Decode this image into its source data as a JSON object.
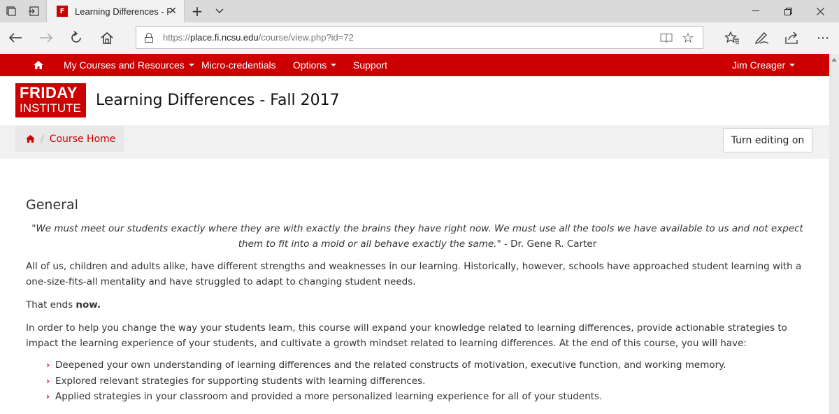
{
  "browser": {
    "tab_title": "Learning Differences - F",
    "url_prefix": "https://",
    "url_host": "place.fi.ncsu.edu",
    "url_path": "/course/view.php?id=72"
  },
  "sitenav": {
    "items": [
      {
        "label": "My Courses and Resources",
        "dropdown": true
      },
      {
        "label": "Micro-credentials",
        "dropdown": false
      },
      {
        "label": "Options",
        "dropdown": true
      },
      {
        "label": "Support",
        "dropdown": false
      }
    ],
    "user": "Jim Creager"
  },
  "header": {
    "logo_line1": "FRIDAY",
    "logo_line2": "INSTITUTE",
    "course_title": "Learning Differences - Fall 2017"
  },
  "breadcrumb": {
    "separator": "/",
    "current": "Course Home"
  },
  "edit_button": "Turn editing on",
  "content": {
    "heading": "General",
    "quote_text": "\"We must meet our students exactly where they are with exactly the brains they have right now. We must use all the tools we have available to us and not expect them to fit into a mold or all behave exactly the same.\"",
    "quote_author": "- Dr. Gene R. Carter",
    "para1": "All of us, children and adults alike, have different strengths and weaknesses in our learning. Historically, however, schools have approached student learning with a one-size-fits-all mentality and have struggled to adapt to changing student needs.",
    "para2_prefix": "That ends ",
    "para2_bold": "now.",
    "para3": "In order to help you change the way your students learn, this course will expand your knowledge related to learning differences, provide actionable strategies to impact the learning experience of your students, and cultivate a growth mindset related to learning differences. At the end of this course, you will have:",
    "list": [
      "Deepened your own understanding of learning differences and the related constructs of motivation, executive function, and working memory.",
      "Explored relevant strategies for supporting students with learning differences.",
      "Applied strategies in your classroom and provided a more personalized learning experience for all of your students."
    ]
  },
  "colors": {
    "brand_red": "#cc0000"
  }
}
